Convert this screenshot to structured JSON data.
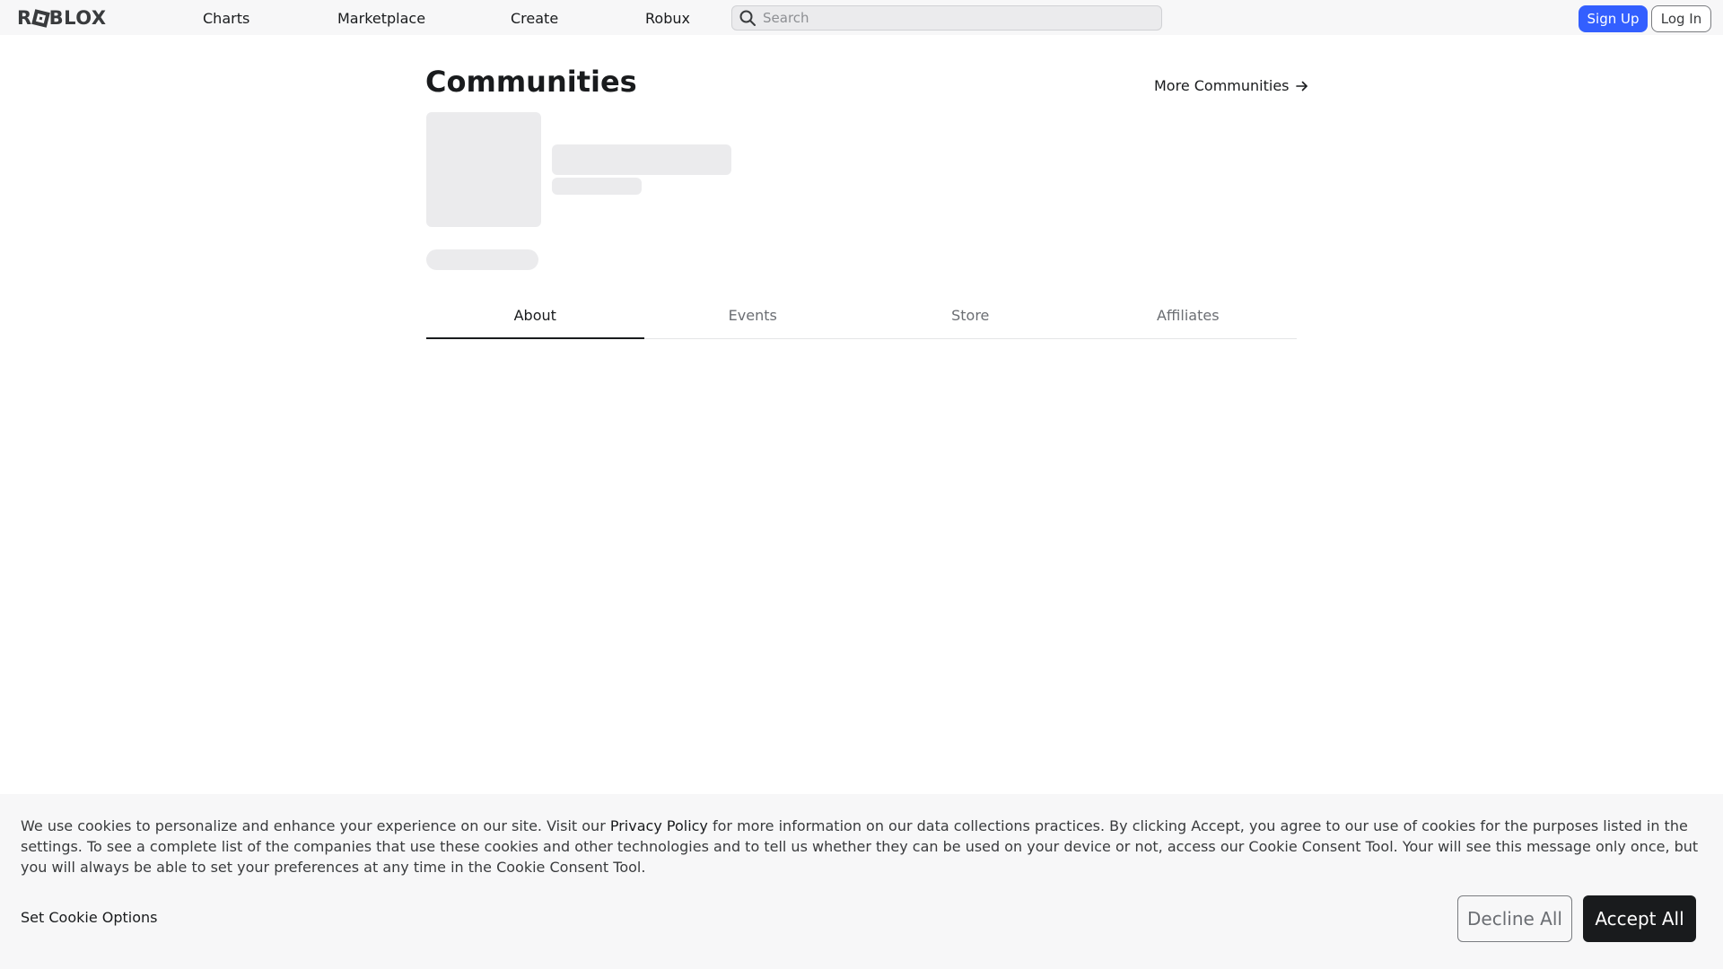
{
  "header": {
    "logo_text_left": "R",
    "logo_text_right": "BLOX",
    "nav": [
      "Charts",
      "Marketplace",
      "Create",
      "Robux"
    ],
    "search": {
      "placeholder": "Search",
      "icon": "search-icon"
    },
    "sign_up": "Sign Up",
    "log_in": "Log In"
  },
  "main": {
    "title": "Communities",
    "more_link": "More Communities",
    "more_icon": "arrow-right-icon",
    "tabs": [
      {
        "label": "About",
        "active": true
      },
      {
        "label": "Events",
        "active": false
      },
      {
        "label": "Store",
        "active": false
      },
      {
        "label": "Affiliates",
        "active": false
      }
    ]
  },
  "cookie": {
    "text_before": "We use cookies to personalize and enhance your experience on our site. Visit our ",
    "policy_link": "Privacy Policy",
    "text_after": " for more information on our data collections practices. By clicking Accept, you agree to our use of cookies for the purposes listed in the settings. To see a complete list of the companies that use these cookies and other technologies and to tell us whether they can be used on your device or not, access our Cookie Consent Tool. Your will see this message only once, but you will always be able to set your preferences at any time in the Cookie Consent Tool.",
    "options_link": "Set Cookie Options",
    "decline": "Decline All",
    "accept": "Accept All"
  },
  "colors": {
    "brand_blue": "#335fff",
    "dark": "#191b1d",
    "skeleton": "#ebebed",
    "banner_bg": "#f7f7f8"
  }
}
